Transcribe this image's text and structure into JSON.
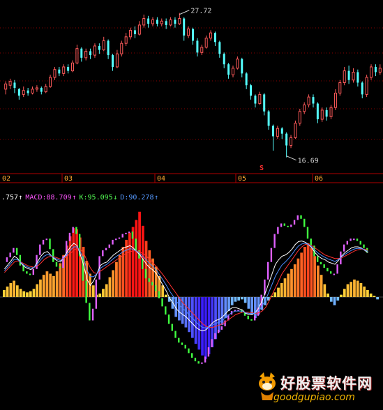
{
  "chart_data": [
    {
      "type": "candlestick",
      "title": "",
      "up_color": "#ff5a5a",
      "down_color": "#54ffff",
      "xlabel": "",
      "ylabel": "",
      "x_ticks": [
        "02",
        "03",
        "04",
        "05",
        "06"
      ],
      "ylim": [
        15.5,
        28.5
      ],
      "annotations": {
        "high_label": "27.72",
        "low_label": "16.69",
        "marker": "S"
      },
      "gridlines": "dotted-red",
      "candles": [
        {
          "o": 21.9,
          "c": 22.3,
          "h": 22.5,
          "l": 21.5
        },
        {
          "o": 22.2,
          "c": 22.5,
          "h": 22.7,
          "l": 21.9
        },
        {
          "o": 22.4,
          "c": 22.0,
          "h": 22.6,
          "l": 21.6
        },
        {
          "o": 21.9,
          "c": 21.4,
          "h": 22.0,
          "l": 21.1
        },
        {
          "o": 21.5,
          "c": 21.8,
          "h": 22.1,
          "l": 21.3
        },
        {
          "o": 21.8,
          "c": 21.6,
          "h": 22.0,
          "l": 21.4
        },
        {
          "o": 21.6,
          "c": 21.9,
          "h": 22.1,
          "l": 21.5
        },
        {
          "o": 21.9,
          "c": 22.0,
          "h": 22.2,
          "l": 21.7
        },
        {
          "o": 22.0,
          "c": 21.7,
          "h": 22.1,
          "l": 21.5
        },
        {
          "o": 21.7,
          "c": 22.1,
          "h": 22.3,
          "l": 21.6
        },
        {
          "o": 22.1,
          "c": 22.8,
          "h": 23.0,
          "l": 22.0
        },
        {
          "o": 22.8,
          "c": 23.4,
          "h": 23.6,
          "l": 22.6
        },
        {
          "o": 23.4,
          "c": 23.1,
          "h": 23.6,
          "l": 22.9
        },
        {
          "o": 23.1,
          "c": 23.6,
          "h": 23.8,
          "l": 22.9
        },
        {
          "o": 23.6,
          "c": 23.3,
          "h": 23.8,
          "l": 23.1
        },
        {
          "o": 23.3,
          "c": 23.9,
          "h": 24.1,
          "l": 23.2
        },
        {
          "o": 23.9,
          "c": 25.0,
          "h": 25.3,
          "l": 23.8
        },
        {
          "o": 25.0,
          "c": 24.3,
          "h": 25.1,
          "l": 24.0
        },
        {
          "o": 24.3,
          "c": 24.8,
          "h": 25.0,
          "l": 24.1
        },
        {
          "o": 24.8,
          "c": 24.5,
          "h": 25.0,
          "l": 24.2
        },
        {
          "o": 24.5,
          "c": 25.2,
          "h": 25.4,
          "l": 24.3
        },
        {
          "o": 25.2,
          "c": 24.9,
          "h": 25.4,
          "l": 24.6
        },
        {
          "o": 24.9,
          "c": 25.6,
          "h": 25.9,
          "l": 24.8
        },
        {
          "o": 25.6,
          "c": 24.5,
          "h": 25.7,
          "l": 24.2
        },
        {
          "o": 24.5,
          "c": 23.6,
          "h": 24.6,
          "l": 23.3
        },
        {
          "o": 23.6,
          "c": 24.6,
          "h": 24.9,
          "l": 23.5
        },
        {
          "o": 24.6,
          "c": 25.4,
          "h": 25.6,
          "l": 24.4
        },
        {
          "o": 25.4,
          "c": 25.9,
          "h": 26.2,
          "l": 25.2
        },
        {
          "o": 25.9,
          "c": 26.4,
          "h": 26.6,
          "l": 25.7
        },
        {
          "o": 26.4,
          "c": 26.1,
          "h": 26.7,
          "l": 25.8
        },
        {
          "o": 26.1,
          "c": 26.8,
          "h": 27.1,
          "l": 26.0
        },
        {
          "o": 26.8,
          "c": 27.3,
          "h": 27.6,
          "l": 26.6
        },
        {
          "o": 27.3,
          "c": 26.9,
          "h": 27.5,
          "l": 26.6
        },
        {
          "o": 26.9,
          "c": 27.2,
          "h": 27.4,
          "l": 26.7
        },
        {
          "o": 27.2,
          "c": 26.9,
          "h": 27.4,
          "l": 26.7
        },
        {
          "o": 26.9,
          "c": 27.1,
          "h": 27.3,
          "l": 26.7
        },
        {
          "o": 27.1,
          "c": 26.8,
          "h": 27.3,
          "l": 26.5
        },
        {
          "o": 26.8,
          "c": 27.2,
          "h": 27.4,
          "l": 26.7
        },
        {
          "o": 27.2,
          "c": 26.9,
          "h": 27.4,
          "l": 26.6
        },
        {
          "o": 26.9,
          "c": 27.3,
          "h": 27.72,
          "l": 26.8
        },
        {
          "o": 27.3,
          "c": 26.0,
          "h": 27.4,
          "l": 25.6
        },
        {
          "o": 26.0,
          "c": 26.5,
          "h": 26.7,
          "l": 25.8
        },
        {
          "o": 26.5,
          "c": 25.6,
          "h": 26.6,
          "l": 25.3
        },
        {
          "o": 25.6,
          "c": 24.7,
          "h": 25.8,
          "l": 24.4
        },
        {
          "o": 24.7,
          "c": 25.1,
          "h": 25.3,
          "l": 24.5
        },
        {
          "o": 25.1,
          "c": 25.8,
          "h": 26.0,
          "l": 25.0
        },
        {
          "o": 25.8,
          "c": 26.2,
          "h": 26.4,
          "l": 25.6
        },
        {
          "o": 26.2,
          "c": 25.5,
          "h": 26.3,
          "l": 25.2
        },
        {
          "o": 25.5,
          "c": 24.6,
          "h": 25.6,
          "l": 24.3
        },
        {
          "o": 24.6,
          "c": 23.8,
          "h": 24.7,
          "l": 23.5
        },
        {
          "o": 23.8,
          "c": 23.0,
          "h": 23.9,
          "l": 22.7
        },
        {
          "o": 23.0,
          "c": 23.5,
          "h": 23.7,
          "l": 22.8
        },
        {
          "o": 23.5,
          "c": 24.2,
          "h": 24.4,
          "l": 23.4
        },
        {
          "o": 24.2,
          "c": 23.1,
          "h": 24.3,
          "l": 22.8
        },
        {
          "o": 23.1,
          "c": 22.2,
          "h": 23.2,
          "l": 21.9
        },
        {
          "o": 22.2,
          "c": 21.4,
          "h": 22.3,
          "l": 21.1
        },
        {
          "o": 21.4,
          "c": 20.8,
          "h": 21.5,
          "l": 20.5
        },
        {
          "o": 20.8,
          "c": 21.5,
          "h": 21.7,
          "l": 20.7
        },
        {
          "o": 21.5,
          "c": 20.2,
          "h": 21.6,
          "l": 19.9
        },
        {
          "o": 20.2,
          "c": 19.1,
          "h": 20.3,
          "l": 18.8
        },
        {
          "o": 19.1,
          "c": 18.3,
          "h": 19.2,
          "l": 17.2
        },
        {
          "o": 18.3,
          "c": 18.9,
          "h": 19.1,
          "l": 18.1
        },
        {
          "o": 18.9,
          "c": 18.5,
          "h": 19.0,
          "l": 18.1
        },
        {
          "o": 18.5,
          "c": 17.6,
          "h": 18.6,
          "l": 16.69
        },
        {
          "o": 17.6,
          "c": 18.2,
          "h": 18.4,
          "l": 17.4
        },
        {
          "o": 18.2,
          "c": 19.3,
          "h": 19.5,
          "l": 18.1
        },
        {
          "o": 19.3,
          "c": 20.2,
          "h": 20.4,
          "l": 19.1
        },
        {
          "o": 20.2,
          "c": 20.7,
          "h": 20.9,
          "l": 20.0
        },
        {
          "o": 20.7,
          "c": 21.3,
          "h": 21.5,
          "l": 20.5
        },
        {
          "o": 21.3,
          "c": 20.8,
          "h": 21.5,
          "l": 20.5
        },
        {
          "o": 20.8,
          "c": 19.6,
          "h": 20.9,
          "l": 19.3
        },
        {
          "o": 19.6,
          "c": 20.3,
          "h": 20.5,
          "l": 19.4
        },
        {
          "o": 20.3,
          "c": 19.8,
          "h": 20.5,
          "l": 19.5
        },
        {
          "o": 19.8,
          "c": 20.5,
          "h": 20.7,
          "l": 19.6
        },
        {
          "o": 20.5,
          "c": 21.6,
          "h": 21.9,
          "l": 20.3
        },
        {
          "o": 21.6,
          "c": 22.4,
          "h": 22.6,
          "l": 21.4
        },
        {
          "o": 22.4,
          "c": 23.3,
          "h": 23.6,
          "l": 22.2
        },
        {
          "o": 23.3,
          "c": 22.6,
          "h": 23.7,
          "l": 22.3
        },
        {
          "o": 22.6,
          "c": 23.2,
          "h": 23.5,
          "l": 22.4
        },
        {
          "o": 23.2,
          "c": 22.4,
          "h": 23.4,
          "l": 22.1
        },
        {
          "o": 22.4,
          "c": 21.5,
          "h": 22.5,
          "l": 21.2
        },
        {
          "o": 21.5,
          "c": 22.8,
          "h": 23.0,
          "l": 21.3
        },
        {
          "o": 22.8,
          "c": 23.6,
          "h": 23.8,
          "l": 22.6
        },
        {
          "o": 23.6,
          "c": 23.2,
          "h": 23.8,
          "l": 22.9
        },
        {
          "o": 23.2,
          "c": 23.5,
          "h": 23.8,
          "l": 23.0
        }
      ]
    },
    {
      "type": "indicator",
      "legend": [
        {
          "text": ".757",
          "arrow": "↑",
          "color": "#ffffff"
        },
        {
          "text": "MACD:88.709",
          "arrow": "↑",
          "color": "#ff55ff"
        },
        {
          "text": "K:95.095",
          "arrow": "↓",
          "color": "#55ff55"
        },
        {
          "text": "D:90.278",
          "arrow": "↑",
          "color": "#5599ff"
        }
      ],
      "ylim": [
        -120,
        160
      ],
      "macd": [
        12,
        18,
        24,
        28,
        20,
        14,
        10,
        8,
        10,
        14,
        22,
        30,
        38,
        44,
        40,
        36,
        44,
        58,
        72,
        88,
        104,
        118,
        116,
        102,
        86,
        62,
        40,
        20,
        4,
        6,
        14,
        22,
        34,
        46,
        60,
        72,
        86,
        98,
        110,
        120,
        132,
        146,
        122,
        96,
        80,
        66,
        52,
        36,
        20,
        4,
        -8,
        -20,
        -34,
        -40,
        -46,
        -52,
        -60,
        -70,
        -80,
        -90,
        -100,
        -106,
        -98,
        -86,
        -72,
        -60,
        -48,
        -36,
        -24,
        -14,
        -8,
        -6,
        -4,
        -10,
        -20,
        -30,
        -36,
        -30,
        -22,
        -14,
        -6,
        2,
        8,
        16,
        24,
        32,
        40,
        48,
        56,
        66,
        76,
        86,
        92,
        84,
        70,
        54,
        38,
        22,
        6,
        -8,
        -14,
        -6,
        4,
        14,
        22,
        26,
        30,
        28,
        24,
        18,
        12,
        6,
        2,
        -4
      ],
      "k": [
        48,
        55,
        62,
        70,
        66,
        58,
        52,
        49,
        47,
        51,
        60,
        70,
        76,
        78,
        72,
        66,
        62,
        60,
        68,
        78,
        86,
        92,
        88,
        72,
        54,
        30,
        20,
        28,
        40,
        54,
        58,
        60,
        66,
        72,
        76,
        80,
        84,
        86,
        88,
        84,
        78,
        72,
        64,
        56,
        50,
        46,
        40,
        30,
        20,
        10,
        -2,
        -10,
        -20,
        -26,
        -30,
        -34,
        -40,
        -46,
        -52,
        -56,
        -58,
        -56,
        -50,
        -44,
        -40,
        -38,
        -34,
        -28,
        -22,
        -18,
        -18,
        -20,
        -22,
        -28,
        -30,
        -30,
        -26,
        -18,
        -6,
        8,
        24,
        40,
        56,
        64,
        70,
        72,
        76,
        82,
        90,
        95,
        96,
        94,
        90,
        84,
        76,
        70,
        66,
        64,
        60,
        58,
        56,
        62,
        70,
        76,
        80,
        84,
        86,
        86,
        84,
        80,
        76
      ],
      "d": [
        42,
        48,
        54,
        60,
        62,
        60,
        57,
        54,
        52,
        51,
        53,
        58,
        64,
        68,
        70,
        69,
        67,
        65,
        66,
        70,
        75,
        80,
        84,
        82,
        75,
        62,
        50,
        42,
        40,
        44,
        48,
        52,
        56,
        60,
        64,
        68,
        72,
        75,
        78,
        79,
        79,
        77,
        74,
        70,
        64,
        58,
        52,
        45,
        38,
        30,
        22,
        14,
        6,
        -2,
        -10,
        -16,
        -22,
        -28,
        -34,
        -40,
        -46,
        -50,
        -52,
        -52,
        -50,
        -48,
        -46,
        -42,
        -38,
        -34,
        -30,
        -28,
        -26,
        -26,
        -26,
        -27,
        -28,
        -27,
        -24,
        -18,
        -8,
        4,
        16,
        28,
        40,
        48,
        56,
        64,
        72,
        80,
        86,
        90,
        90,
        88,
        84,
        80,
        76,
        72,
        70,
        68,
        66,
        66,
        67,
        70,
        73,
        76,
        79,
        81,
        82,
        82,
        80
      ],
      "j": [
        60,
        68,
        76,
        84,
        72,
        54,
        44,
        40,
        38,
        48,
        72,
        90,
        98,
        100,
        82,
        60,
        52,
        50,
        70,
        96,
        110,
        120,
        108,
        70,
        28,
        -10,
        -40,
        -20,
        30,
        70,
        80,
        84,
        90,
        98,
        100,
        102,
        108,
        110,
        112,
        100,
        80,
        66,
        48,
        32,
        26,
        20,
        10,
        -2,
        -16,
        -30,
        -46,
        -58,
        -70,
        -78,
        -82,
        -88,
        -96,
        -104,
        -110,
        -114,
        -112,
        -102,
        -86,
        -72,
        -62,
        -56,
        -50,
        -40,
        -30,
        -24,
        -22,
        -22,
        -26,
        -32,
        -38,
        -40,
        -32,
        -18,
        4,
        30,
        60,
        84,
        108,
        120,
        126,
        122,
        120,
        124,
        132,
        140,
        134,
        120,
        100,
        88,
        70,
        60,
        56,
        50,
        44,
        40,
        40,
        56,
        78,
        90,
        96,
        100,
        100,
        96,
        90,
        84,
        76
      ],
      "macd_labels": {
        "positive": "#ff3030",
        "negative": "#3060ff"
      }
    }
  ],
  "watermark": {
    "brand": "好股票软件网",
    "domain": "goodgupiao.com"
  },
  "colors": {
    "background": "#000000",
    "grid": "#8b0000",
    "axis": "#b00000",
    "tick_text": "#ffaa33",
    "label_text": "#cfcfcf",
    "marker": "#ff3030"
  }
}
